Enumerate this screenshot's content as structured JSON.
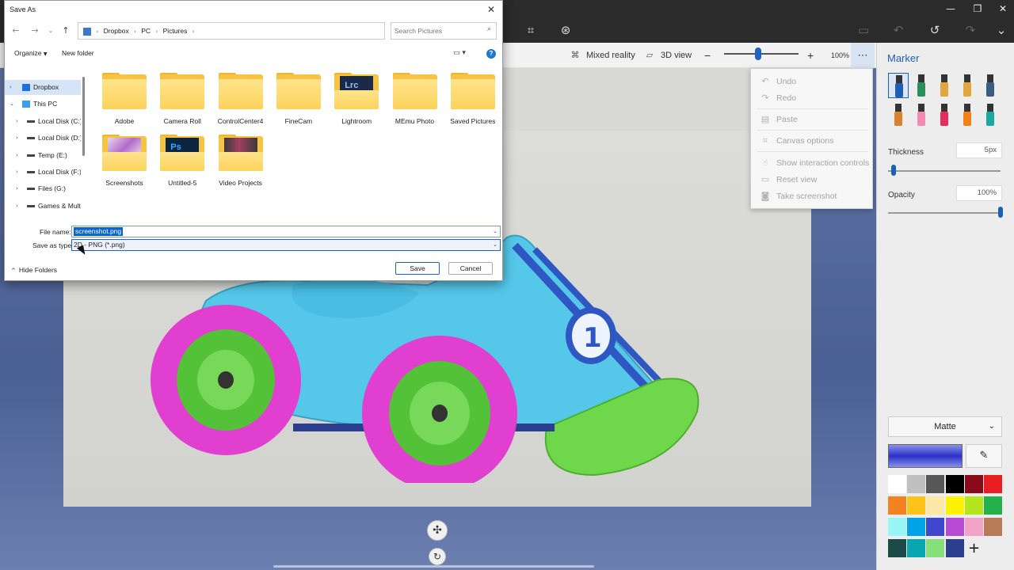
{
  "app": {
    "toolbar": {
      "mixed_reality": "Mixed reality",
      "view_3d": "3D view",
      "zoom_out_icon": "minus-icon",
      "zoom_in_icon": "plus-icon",
      "zoom_level": "100%",
      "zoom_fraction": 0.46,
      "more_icon": "ellipsis-icon"
    },
    "title_icons": [
      "crop-icon",
      "magic-select-icon",
      "paste-icon",
      "undo-icon",
      "history-icon",
      "redo-icon",
      "chevron-down-icon"
    ],
    "more_menu": [
      {
        "label": "Undo",
        "icon": "undo-icon"
      },
      {
        "label": "Redo",
        "icon": "redo-icon"
      },
      {
        "label": "Paste",
        "icon": "paste-icon"
      },
      {
        "label": "Canvas options",
        "icon": "canvas-icon"
      },
      {
        "label": "Show interaction controls",
        "icon": "touch-icon"
      },
      {
        "label": "Reset view",
        "icon": "reset-view-icon"
      },
      {
        "label": "Take screenshot",
        "icon": "camera-icon"
      }
    ]
  },
  "panel": {
    "title": "Marker",
    "brushes": [
      {
        "name": "marker",
        "color": "#1e5fb4"
      },
      {
        "name": "calligraphy-pen",
        "color": "#2c8f5a"
      },
      {
        "name": "oil-brush",
        "color": "#e0a640"
      },
      {
        "name": "watercolor",
        "color": "#e0a640"
      },
      {
        "name": "pixel-pen",
        "color": "#3d5a80"
      },
      {
        "name": "pencil",
        "color": "#d8822d"
      },
      {
        "name": "eraser",
        "color": "#f38ab0"
      },
      {
        "name": "crayon",
        "color": "#e32f5a"
      },
      {
        "name": "spray-can",
        "color": "#f2801b"
      },
      {
        "name": "fill",
        "color": "#19a9a2"
      }
    ],
    "thickness_label": "Thickness",
    "thickness_value": "5px",
    "thickness_fraction": 0.05,
    "opacity_label": "Opacity",
    "opacity_value": "100%",
    "opacity_fraction": 1.0,
    "finish": "Matte",
    "current_color": "#2830c8",
    "palette": [
      "#ffffff",
      "#c0c0c0",
      "#585858",
      "#000000",
      "#8a0a1a",
      "#e81e24",
      "#f58220",
      "#fcc419",
      "#fde8a6",
      "#fff200",
      "#b5e61d",
      "#22b14c",
      "#99f6f6",
      "#00a2e8",
      "#3f48cc",
      "#b84bd4",
      "#f4a3c8",
      "#b97a57",
      "#1c4a48",
      "#08a6b0",
      "#86e07a",
      "#2c3e90"
    ]
  },
  "dialog": {
    "title": "Save As",
    "breadcrumb": [
      "Dropbox",
      "PC",
      "Pictures"
    ],
    "search_placeholder": "Search Pictures",
    "organize": "Organize",
    "new_folder": "New folder",
    "nav": [
      {
        "label": "Dropbox",
        "icon": "dropbox-icon"
      },
      {
        "label": "This PC",
        "icon": "pc-icon"
      },
      {
        "label": "Local Disk (C:)",
        "icon": "drive-icon"
      },
      {
        "label": "Local Disk (D:)",
        "icon": "drive-icon"
      },
      {
        "label": "Temp (E:)",
        "icon": "drive-icon"
      },
      {
        "label": "Local Disk (F:)",
        "icon": "drive-icon"
      },
      {
        "label": "Files (G:)",
        "icon": "drive-icon"
      },
      {
        "label": "Games & Mult",
        "icon": "drive-icon"
      }
    ],
    "folders": [
      {
        "name": "Adobe"
      },
      {
        "name": "Camera Roll"
      },
      {
        "name": "ControlCenter4"
      },
      {
        "name": "FineCam"
      },
      {
        "name": "Lightroom",
        "thumb": "Lrc"
      },
      {
        "name": "MEmu Photo"
      },
      {
        "name": "Saved Pictures"
      },
      {
        "name": "Screenshots"
      },
      {
        "name": "Untitled-5",
        "thumb": "Ps"
      },
      {
        "name": "Video Projects"
      }
    ],
    "file_name_label": "File name:",
    "file_name_value": "screenshot.png",
    "save_type_label": "Save as type:",
    "save_type_value": "2D - PNG (*.png)",
    "save_label": "Save",
    "cancel_label": "Cancel",
    "hide_folders": "Hide Folders"
  }
}
